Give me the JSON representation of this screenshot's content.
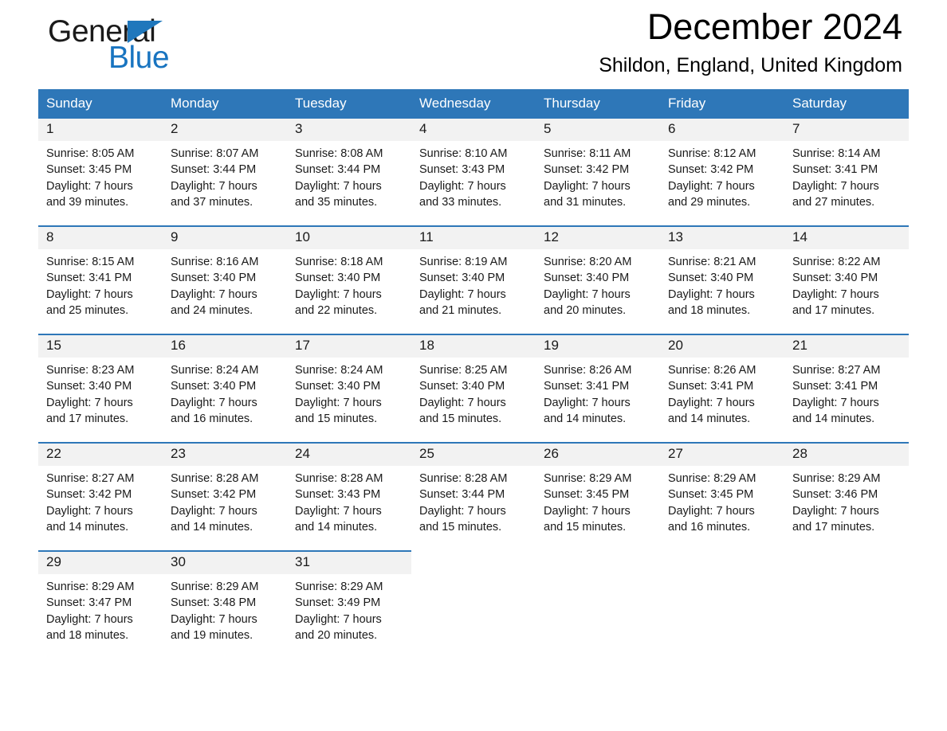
{
  "brand": {
    "name_part1": "General",
    "name_part2": "Blue",
    "triangle_color": "#1f77bc"
  },
  "header": {
    "title": "December 2024",
    "subtitle": "Shildon, England, United Kingdom"
  },
  "theme": {
    "header_blue": "#2e77b8",
    "date_band_gray": "#f2f2f2",
    "text_color": "#1a1a1a"
  },
  "day_headers": [
    "Sunday",
    "Monday",
    "Tuesday",
    "Wednesday",
    "Thursday",
    "Friday",
    "Saturday"
  ],
  "weeks": [
    [
      {
        "date": "1",
        "sunrise": "Sunrise: 8:05 AM",
        "sunset": "Sunset: 3:45 PM",
        "daylight_1": "Daylight: 7 hours",
        "daylight_2": "and 39 minutes."
      },
      {
        "date": "2",
        "sunrise": "Sunrise: 8:07 AM",
        "sunset": "Sunset: 3:44 PM",
        "daylight_1": "Daylight: 7 hours",
        "daylight_2": "and 37 minutes."
      },
      {
        "date": "3",
        "sunrise": "Sunrise: 8:08 AM",
        "sunset": "Sunset: 3:44 PM",
        "daylight_1": "Daylight: 7 hours",
        "daylight_2": "and 35 minutes."
      },
      {
        "date": "4",
        "sunrise": "Sunrise: 8:10 AM",
        "sunset": "Sunset: 3:43 PM",
        "daylight_1": "Daylight: 7 hours",
        "daylight_2": "and 33 minutes."
      },
      {
        "date": "5",
        "sunrise": "Sunrise: 8:11 AM",
        "sunset": "Sunset: 3:42 PM",
        "daylight_1": "Daylight: 7 hours",
        "daylight_2": "and 31 minutes."
      },
      {
        "date": "6",
        "sunrise": "Sunrise: 8:12 AM",
        "sunset": "Sunset: 3:42 PM",
        "daylight_1": "Daylight: 7 hours",
        "daylight_2": "and 29 minutes."
      },
      {
        "date": "7",
        "sunrise": "Sunrise: 8:14 AM",
        "sunset": "Sunset: 3:41 PM",
        "daylight_1": "Daylight: 7 hours",
        "daylight_2": "and 27 minutes."
      }
    ],
    [
      {
        "date": "8",
        "sunrise": "Sunrise: 8:15 AM",
        "sunset": "Sunset: 3:41 PM",
        "daylight_1": "Daylight: 7 hours",
        "daylight_2": "and 25 minutes."
      },
      {
        "date": "9",
        "sunrise": "Sunrise: 8:16 AM",
        "sunset": "Sunset: 3:40 PM",
        "daylight_1": "Daylight: 7 hours",
        "daylight_2": "and 24 minutes."
      },
      {
        "date": "10",
        "sunrise": "Sunrise: 8:18 AM",
        "sunset": "Sunset: 3:40 PM",
        "daylight_1": "Daylight: 7 hours",
        "daylight_2": "and 22 minutes."
      },
      {
        "date": "11",
        "sunrise": "Sunrise: 8:19 AM",
        "sunset": "Sunset: 3:40 PM",
        "daylight_1": "Daylight: 7 hours",
        "daylight_2": "and 21 minutes."
      },
      {
        "date": "12",
        "sunrise": "Sunrise: 8:20 AM",
        "sunset": "Sunset: 3:40 PM",
        "daylight_1": "Daylight: 7 hours",
        "daylight_2": "and 20 minutes."
      },
      {
        "date": "13",
        "sunrise": "Sunrise: 8:21 AM",
        "sunset": "Sunset: 3:40 PM",
        "daylight_1": "Daylight: 7 hours",
        "daylight_2": "and 18 minutes."
      },
      {
        "date": "14",
        "sunrise": "Sunrise: 8:22 AM",
        "sunset": "Sunset: 3:40 PM",
        "daylight_1": "Daylight: 7 hours",
        "daylight_2": "and 17 minutes."
      }
    ],
    [
      {
        "date": "15",
        "sunrise": "Sunrise: 8:23 AM",
        "sunset": "Sunset: 3:40 PM",
        "daylight_1": "Daylight: 7 hours",
        "daylight_2": "and 17 minutes."
      },
      {
        "date": "16",
        "sunrise": "Sunrise: 8:24 AM",
        "sunset": "Sunset: 3:40 PM",
        "daylight_1": "Daylight: 7 hours",
        "daylight_2": "and 16 minutes."
      },
      {
        "date": "17",
        "sunrise": "Sunrise: 8:24 AM",
        "sunset": "Sunset: 3:40 PM",
        "daylight_1": "Daylight: 7 hours",
        "daylight_2": "and 15 minutes."
      },
      {
        "date": "18",
        "sunrise": "Sunrise: 8:25 AM",
        "sunset": "Sunset: 3:40 PM",
        "daylight_1": "Daylight: 7 hours",
        "daylight_2": "and 15 minutes."
      },
      {
        "date": "19",
        "sunrise": "Sunrise: 8:26 AM",
        "sunset": "Sunset: 3:41 PM",
        "daylight_1": "Daylight: 7 hours",
        "daylight_2": "and 14 minutes."
      },
      {
        "date": "20",
        "sunrise": "Sunrise: 8:26 AM",
        "sunset": "Sunset: 3:41 PM",
        "daylight_1": "Daylight: 7 hours",
        "daylight_2": "and 14 minutes."
      },
      {
        "date": "21",
        "sunrise": "Sunrise: 8:27 AM",
        "sunset": "Sunset: 3:41 PM",
        "daylight_1": "Daylight: 7 hours",
        "daylight_2": "and 14 minutes."
      }
    ],
    [
      {
        "date": "22",
        "sunrise": "Sunrise: 8:27 AM",
        "sunset": "Sunset: 3:42 PM",
        "daylight_1": "Daylight: 7 hours",
        "daylight_2": "and 14 minutes."
      },
      {
        "date": "23",
        "sunrise": "Sunrise: 8:28 AM",
        "sunset": "Sunset: 3:42 PM",
        "daylight_1": "Daylight: 7 hours",
        "daylight_2": "and 14 minutes."
      },
      {
        "date": "24",
        "sunrise": "Sunrise: 8:28 AM",
        "sunset": "Sunset: 3:43 PM",
        "daylight_1": "Daylight: 7 hours",
        "daylight_2": "and 14 minutes."
      },
      {
        "date": "25",
        "sunrise": "Sunrise: 8:28 AM",
        "sunset": "Sunset: 3:44 PM",
        "daylight_1": "Daylight: 7 hours",
        "daylight_2": "and 15 minutes."
      },
      {
        "date": "26",
        "sunrise": "Sunrise: 8:29 AM",
        "sunset": "Sunset: 3:45 PM",
        "daylight_1": "Daylight: 7 hours",
        "daylight_2": "and 15 minutes."
      },
      {
        "date": "27",
        "sunrise": "Sunrise: 8:29 AM",
        "sunset": "Sunset: 3:45 PM",
        "daylight_1": "Daylight: 7 hours",
        "daylight_2": "and 16 minutes."
      },
      {
        "date": "28",
        "sunrise": "Sunrise: 8:29 AM",
        "sunset": "Sunset: 3:46 PM",
        "daylight_1": "Daylight: 7 hours",
        "daylight_2": "and 17 minutes."
      }
    ],
    [
      {
        "date": "29",
        "sunrise": "Sunrise: 8:29 AM",
        "sunset": "Sunset: 3:47 PM",
        "daylight_1": "Daylight: 7 hours",
        "daylight_2": "and 18 minutes."
      },
      {
        "date": "30",
        "sunrise": "Sunrise: 8:29 AM",
        "sunset": "Sunset: 3:48 PM",
        "daylight_1": "Daylight: 7 hours",
        "daylight_2": "and 19 minutes."
      },
      {
        "date": "31",
        "sunrise": "Sunrise: 8:29 AM",
        "sunset": "Sunset: 3:49 PM",
        "daylight_1": "Daylight: 7 hours",
        "daylight_2": "and 20 minutes."
      },
      {
        "date": "",
        "sunrise": "",
        "sunset": "",
        "daylight_1": "",
        "daylight_2": ""
      },
      {
        "date": "",
        "sunrise": "",
        "sunset": "",
        "daylight_1": "",
        "daylight_2": ""
      },
      {
        "date": "",
        "sunrise": "",
        "sunset": "",
        "daylight_1": "",
        "daylight_2": ""
      },
      {
        "date": "",
        "sunrise": "",
        "sunset": "",
        "daylight_1": "",
        "daylight_2": ""
      }
    ]
  ]
}
